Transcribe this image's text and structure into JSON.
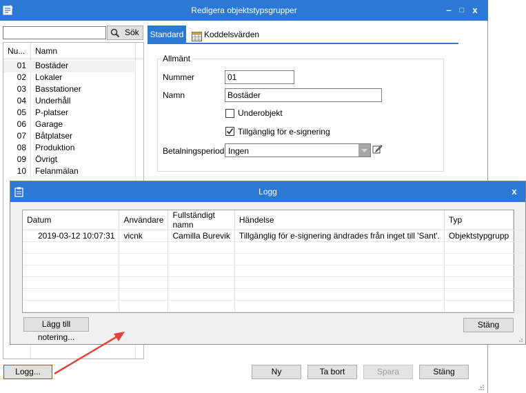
{
  "main_window": {
    "title": "Redigera objektstypsgrupper",
    "minimize_glyph": "–",
    "maximize_glyph": "□",
    "close_glyph": "x"
  },
  "search": {
    "value": "",
    "button_label": "Sök"
  },
  "list": {
    "columns": [
      "Nu...",
      "Namn"
    ],
    "rows": [
      {
        "num": "01",
        "name": "Bostäder"
      },
      {
        "num": "02",
        "name": "Lokaler"
      },
      {
        "num": "03",
        "name": "Basstationer"
      },
      {
        "num": "04",
        "name": "Underhåll"
      },
      {
        "num": "05",
        "name": "P-platser"
      },
      {
        "num": "06",
        "name": "Garage"
      },
      {
        "num": "07",
        "name": "Båtplatser"
      },
      {
        "num": "08",
        "name": "Produktion"
      },
      {
        "num": "09",
        "name": "Övrigt"
      },
      {
        "num": "10",
        "name": "Felanmälan"
      }
    ]
  },
  "tabs": {
    "standard": "Standard",
    "koddelsvarden": "Koddelsvärden"
  },
  "form": {
    "group_label": "Allmänt",
    "nummer_label": "Nummer",
    "nummer_value": "01",
    "namn_label": "Namn",
    "namn_value": "Bostäder",
    "underobjekt_label": "Underobjekt",
    "tillganglig_label": "Tillgänglig för e-signering",
    "betalningsperiod_label": "Betalningsperiod",
    "betalningsperiod_value": "Ingen"
  },
  "bottom_buttons": {
    "logg": "Logg...",
    "ny": "Ny",
    "ta_bort": "Ta bort",
    "spara": "Spara",
    "stang": "Stäng"
  },
  "log_dialog": {
    "title": "Logg",
    "close_glyph": "x",
    "columns": [
      "Datum",
      "Användare",
      "Fullständigt namn",
      "Händelse",
      "Typ"
    ],
    "rows": [
      {
        "datum": "2019-03-12 10:07:31",
        "anvandare": "vicnk",
        "namn": "Camilla Burevik",
        "handelse": "Tillgänglig för e-signering ändrades från inget till 'Sant'.",
        "typ": "Objektstypgrupp"
      }
    ],
    "add_note_button": "Lägg till notering...",
    "close_button": "Stäng"
  },
  "colors": {
    "titlebar": "#2b79d5",
    "tab_active": "#2b79d5",
    "annotation_arrow": "#e0443a"
  }
}
